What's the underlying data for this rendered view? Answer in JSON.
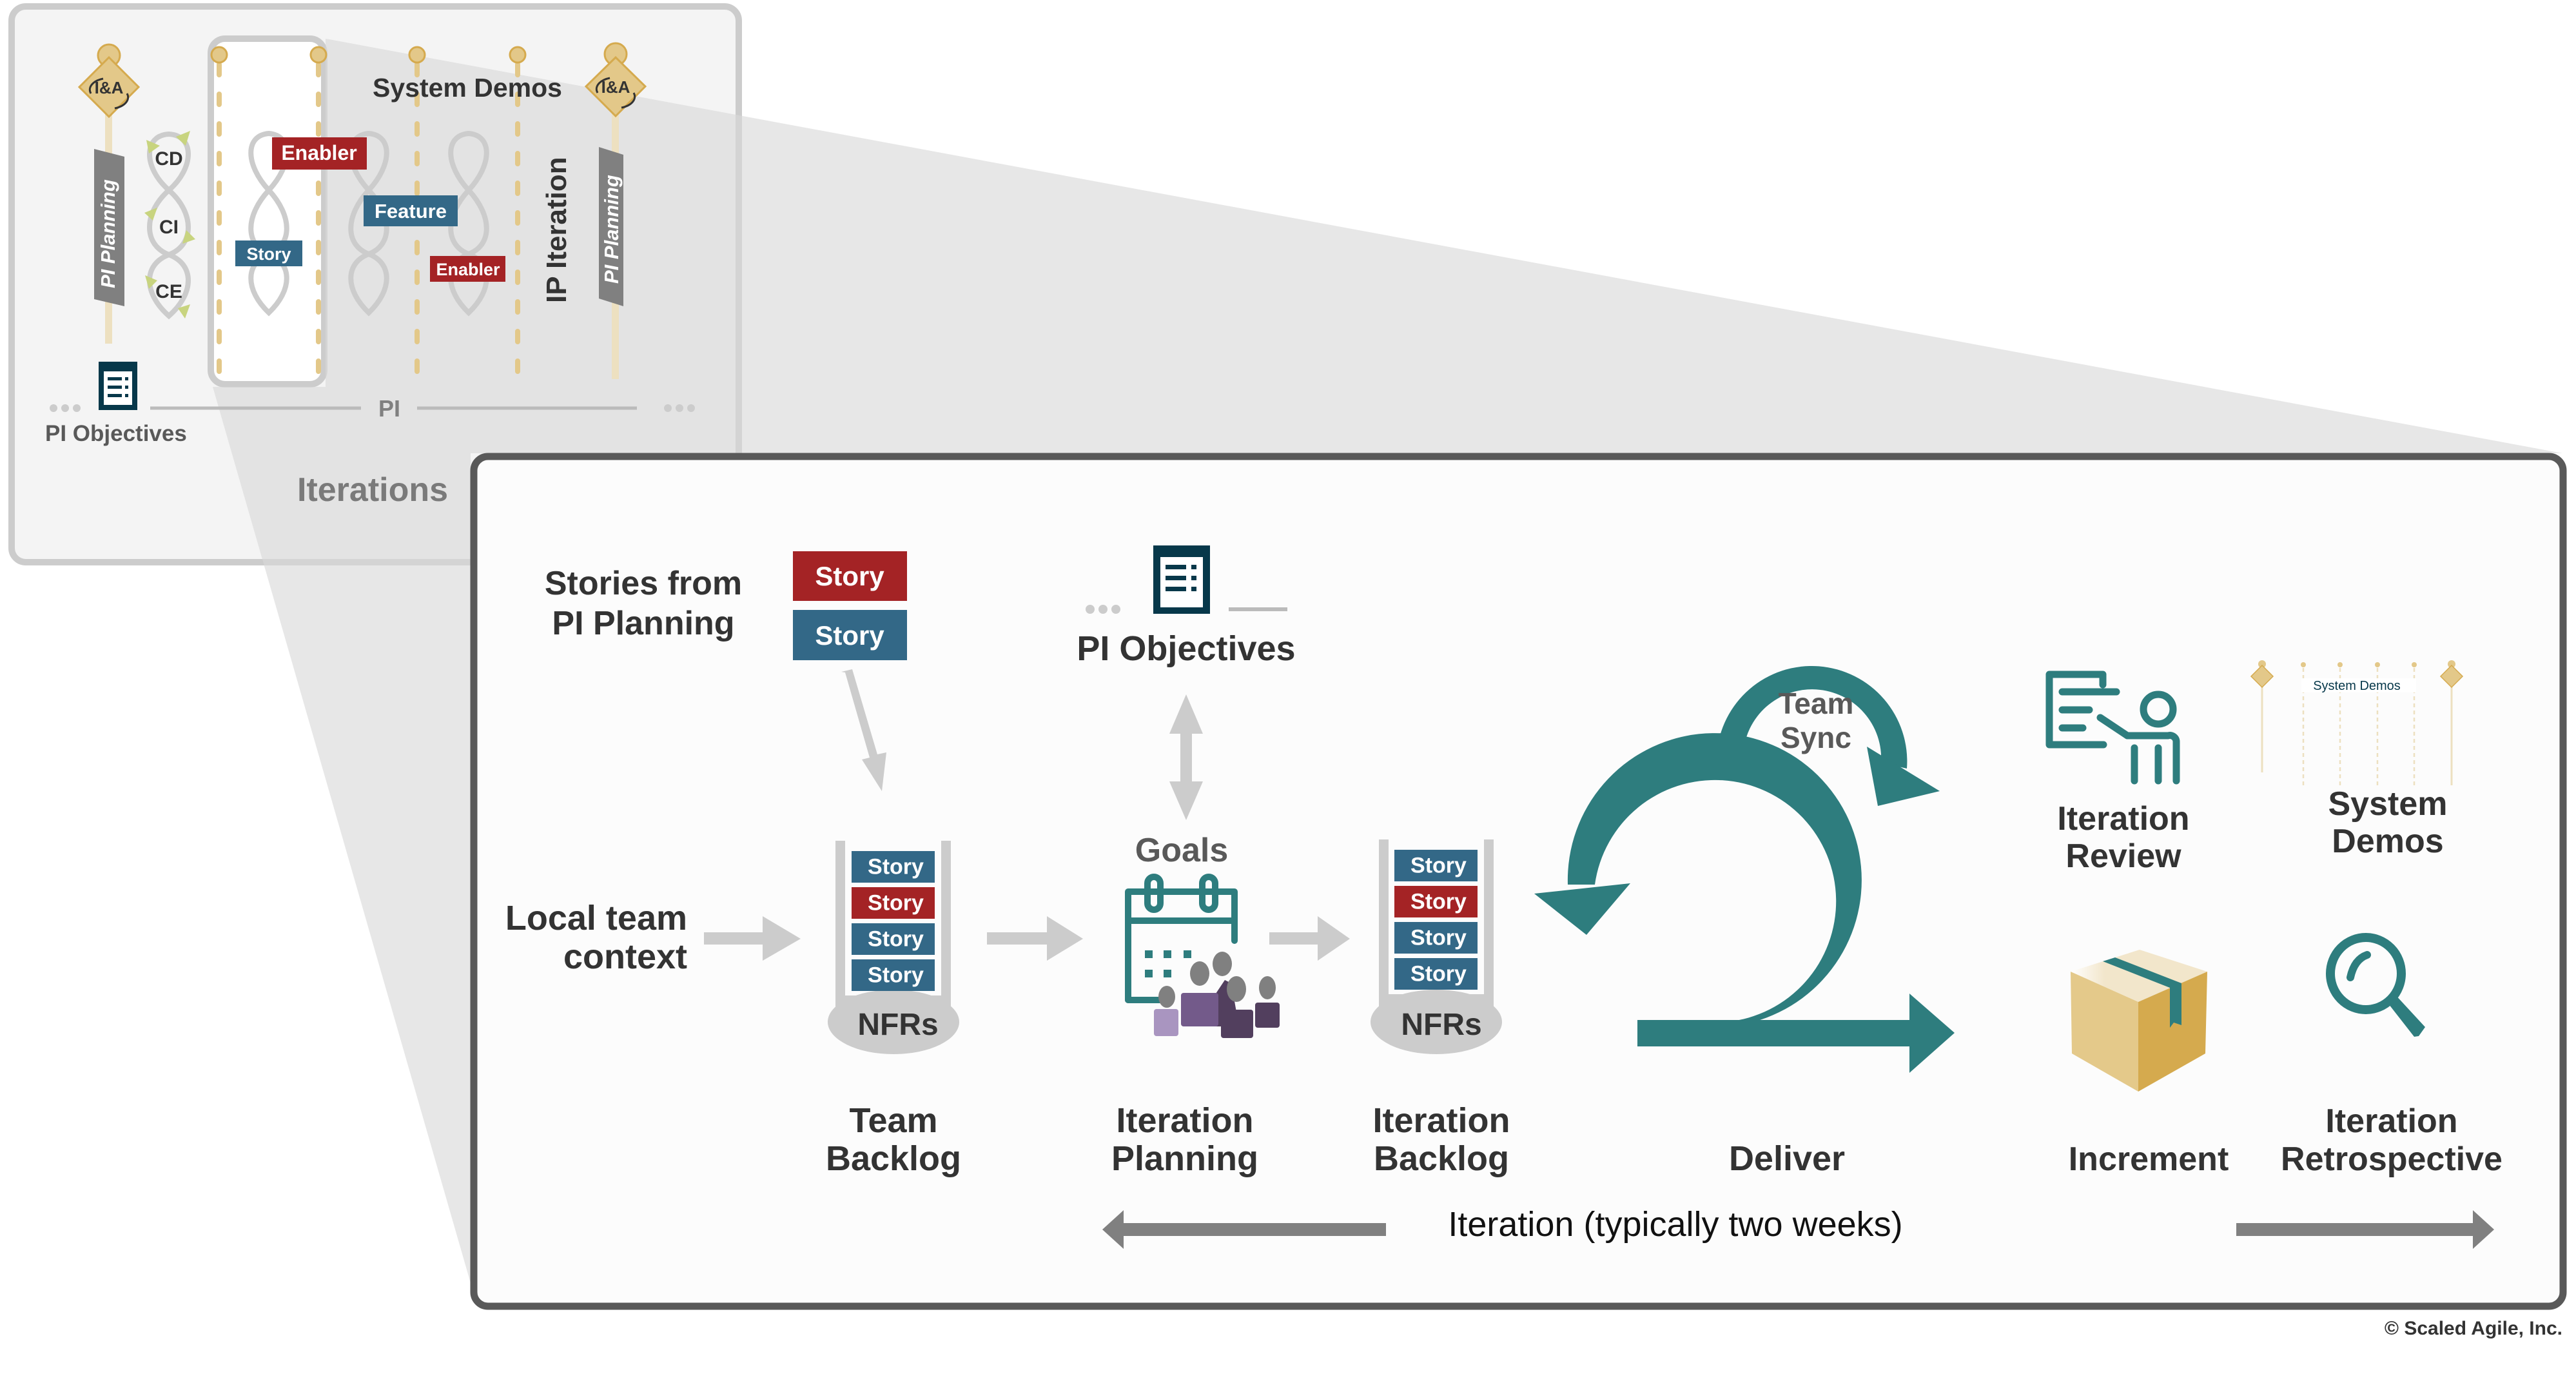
{
  "colors": {
    "story_red": "#A42325",
    "story_blue": "#336887",
    "teal": "#2E7D7E",
    "dark_teal": "#07384A",
    "gold": "#E3C889",
    "gold_dark": "#D5AA4E",
    "gray_arrow": "#CCCCCC",
    "dark_gray": "#808080",
    "frame": "#595959",
    "text": "#333333"
  },
  "pi_overview": {
    "left_milestone": {
      "icon": "inspect-and-adapt-icon",
      "text": "I&A"
    },
    "right_milestone": {
      "icon": "inspect-and-adapt-icon",
      "text": "I&A"
    },
    "left_banner": "PI Planning",
    "right_banner": "PI Planning",
    "devops_loop": [
      "CD",
      "CI",
      "CE"
    ],
    "system_demos_label": "System Demos",
    "chips": [
      {
        "label": "Enabler",
        "kind": "enabler"
      },
      {
        "label": "Story",
        "kind": "story"
      },
      {
        "label": "Feature",
        "kind": "feature"
      },
      {
        "label": "Enabler",
        "kind": "enabler"
      }
    ],
    "ip_iteration_label": "IP Iteration",
    "pi_label": "PI",
    "pi_objectives_label": "PI Objectives",
    "ellipsis": "...",
    "iterations_label": "Iterations"
  },
  "iteration": {
    "stories_from_label_line1": "Stories from",
    "stories_from_label_line2": "PI Planning",
    "incoming_stories": [
      {
        "label": "Story",
        "kind": "enabler"
      },
      {
        "label": "Story",
        "kind": "story"
      }
    ],
    "pi_objectives_label": "PI Objectives",
    "local_context_line1": "Local team",
    "local_context_line2": "context",
    "team_backlog": {
      "items": [
        {
          "label": "Story",
          "kind": "story"
        },
        {
          "label": "Story",
          "kind": "enabler"
        },
        {
          "label": "Story",
          "kind": "story"
        },
        {
          "label": "Story",
          "kind": "story"
        }
      ],
      "base_label": "NFRs",
      "title_line1": "Team",
      "title_line2": "Backlog"
    },
    "goals_label": "Goals",
    "iteration_planning": {
      "title_line1": "Iteration",
      "title_line2": "Planning"
    },
    "iteration_backlog": {
      "items": [
        {
          "label": "Story",
          "kind": "story"
        },
        {
          "label": "Story",
          "kind": "enabler"
        },
        {
          "label": "Story",
          "kind": "story"
        },
        {
          "label": "Story",
          "kind": "story"
        }
      ],
      "base_label": "NFRs",
      "title_line1": "Iteration",
      "title_line2": "Backlog"
    },
    "team_sync_line1": "Team",
    "team_sync_line2": "Sync",
    "deliver_label": "Deliver",
    "iteration_review": {
      "title_line1": "Iteration",
      "title_line2": "Review"
    },
    "system_demos": {
      "mini_label": "System Demos",
      "title_line1": "System",
      "title_line2": "Demos"
    },
    "increment_label": "Increment",
    "retrospective": {
      "title_line1": "Iteration",
      "title_line2": "Retrospective"
    },
    "duration_label": "Iteration (typically two weeks)"
  },
  "copyright": "© Scaled Agile, Inc."
}
